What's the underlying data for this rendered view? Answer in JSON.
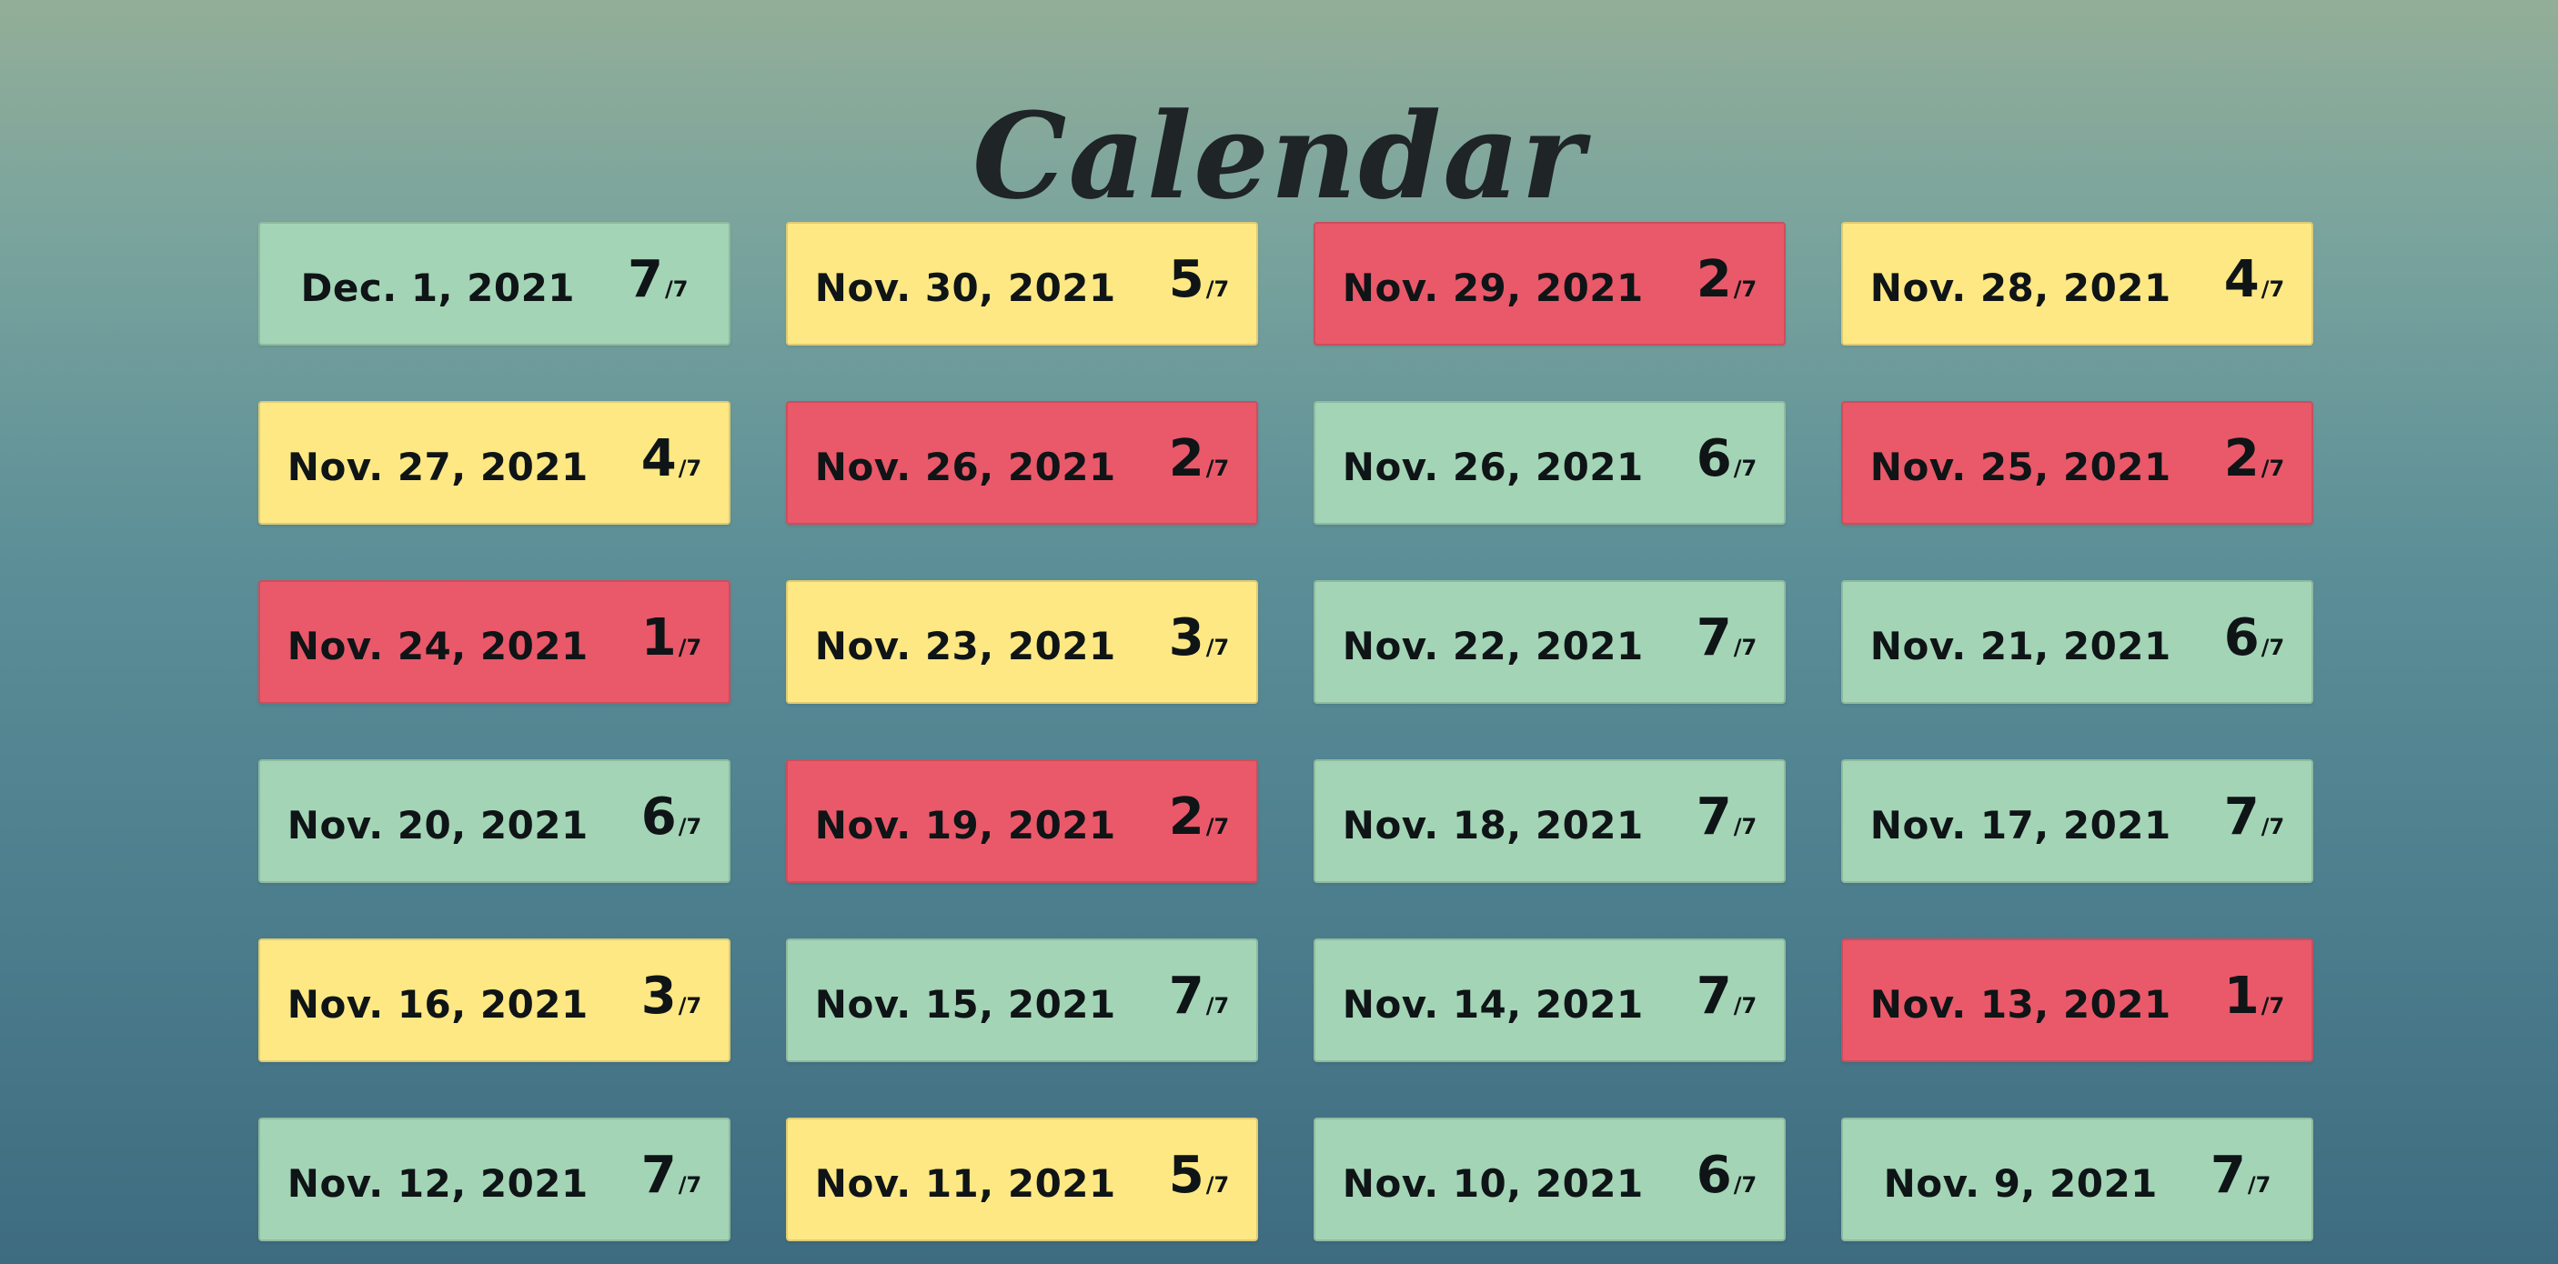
{
  "page": {
    "title": "Calendar"
  },
  "colors": {
    "green": "#a3d4b6",
    "yellow": "#fde884",
    "red": "#e9596a"
  },
  "days": [
    {
      "date": "Dec. 1, 2021",
      "score": "7",
      "total": "/7",
      "status": "green"
    },
    {
      "date": "Nov. 30, 2021",
      "score": "5",
      "total": "/7",
      "status": "yellow"
    },
    {
      "date": "Nov. 29, 2021",
      "score": "2",
      "total": "/7",
      "status": "red"
    },
    {
      "date": "Nov. 28, 2021",
      "score": "4",
      "total": "/7",
      "status": "yellow"
    },
    {
      "date": "Nov. 27, 2021",
      "score": "4",
      "total": "/7",
      "status": "yellow"
    },
    {
      "date": "Nov. 26, 2021",
      "score": "2",
      "total": "/7",
      "status": "red"
    },
    {
      "date": "Nov. 26, 2021",
      "score": "6",
      "total": "/7",
      "status": "green"
    },
    {
      "date": "Nov. 25, 2021",
      "score": "2",
      "total": "/7",
      "status": "red"
    },
    {
      "date": "Nov. 24, 2021",
      "score": "1",
      "total": "/7",
      "status": "red"
    },
    {
      "date": "Nov. 23, 2021",
      "score": "3",
      "total": "/7",
      "status": "yellow"
    },
    {
      "date": "Nov. 22, 2021",
      "score": "7",
      "total": "/7",
      "status": "green"
    },
    {
      "date": "Nov. 21, 2021",
      "score": "6",
      "total": "/7",
      "status": "green"
    },
    {
      "date": "Nov. 20, 2021",
      "score": "6",
      "total": "/7",
      "status": "green"
    },
    {
      "date": "Nov. 19, 2021",
      "score": "2",
      "total": "/7",
      "status": "red"
    },
    {
      "date": "Nov. 18, 2021",
      "score": "7",
      "total": "/7",
      "status": "green"
    },
    {
      "date": "Nov. 17, 2021",
      "score": "7",
      "total": "/7",
      "status": "green"
    },
    {
      "date": "Nov. 16, 2021",
      "score": "3",
      "total": "/7",
      "status": "yellow"
    },
    {
      "date": "Nov. 15, 2021",
      "score": "7",
      "total": "/7",
      "status": "green"
    },
    {
      "date": "Nov. 14, 2021",
      "score": "7",
      "total": "/7",
      "status": "green"
    },
    {
      "date": "Nov. 13, 2021",
      "score": "1",
      "total": "/7",
      "status": "red"
    },
    {
      "date": "Nov. 12, 2021",
      "score": "7",
      "total": "/7",
      "status": "green"
    },
    {
      "date": "Nov. 11, 2021",
      "score": "5",
      "total": "/7",
      "status": "yellow"
    },
    {
      "date": "Nov. 10, 2021",
      "score": "6",
      "total": "/7",
      "status": "green"
    },
    {
      "date": "Nov. 9, 2021",
      "score": "7",
      "total": "/7",
      "status": "green"
    }
  ]
}
